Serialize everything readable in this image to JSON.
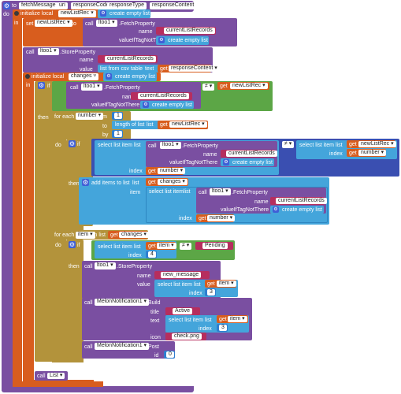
{
  "proc": {
    "to": "to",
    "name": "fetchMessage",
    "params": [
      "uri",
      "responseCode",
      "responseType",
      "responseContent"
    ],
    "do": "do"
  },
  "kw": {
    "initialize_local": "initialize local",
    "to": "to",
    "in": "in",
    "set": "set",
    "call": "call",
    "then": "then",
    "do": "do",
    "if": "if",
    "for_each": "for each",
    "from": "from",
    "by": "by",
    "in_list": "in list",
    "get": "get",
    "name": "name",
    "value": "value",
    "title": "title",
    "text": "text",
    "icon": "icon",
    "id": "id",
    "item": "item",
    "index": "index",
    "list": "list",
    "valueIfTagNotThere": "valueIfTagNotThere"
  },
  "vars": {
    "newListRec": "newListRec",
    "changes": "changes",
    "number": "number",
    "item": "item"
  },
  "components": {
    "db": "ltoo1",
    "notif": "MelonNotification1"
  },
  "methods": {
    "fetch": ".FetchProperty",
    "store": ".StoreProperty",
    "build": ".Build",
    "post": ".Post"
  },
  "lists": {
    "create_empty": "create empty list",
    "from_csv": "list from csv table",
    "text": "text",
    "length": "length of list",
    "list": "list",
    "select": "select list item",
    "add": "add items to list"
  },
  "strings": {
    "currentListRecords": "currentListRecords",
    "responseContent": "responseContent",
    "pending": "Pending",
    "new_message": "new_message",
    "active": "Active",
    "check_png": "check.png"
  },
  "numbers": {
    "one": "1",
    "four": "4",
    "three": "3",
    "zero": "0"
  },
  "ops": {
    "neq": "≠"
  },
  "final": {
    "call": "call",
    "list": "List"
  }
}
